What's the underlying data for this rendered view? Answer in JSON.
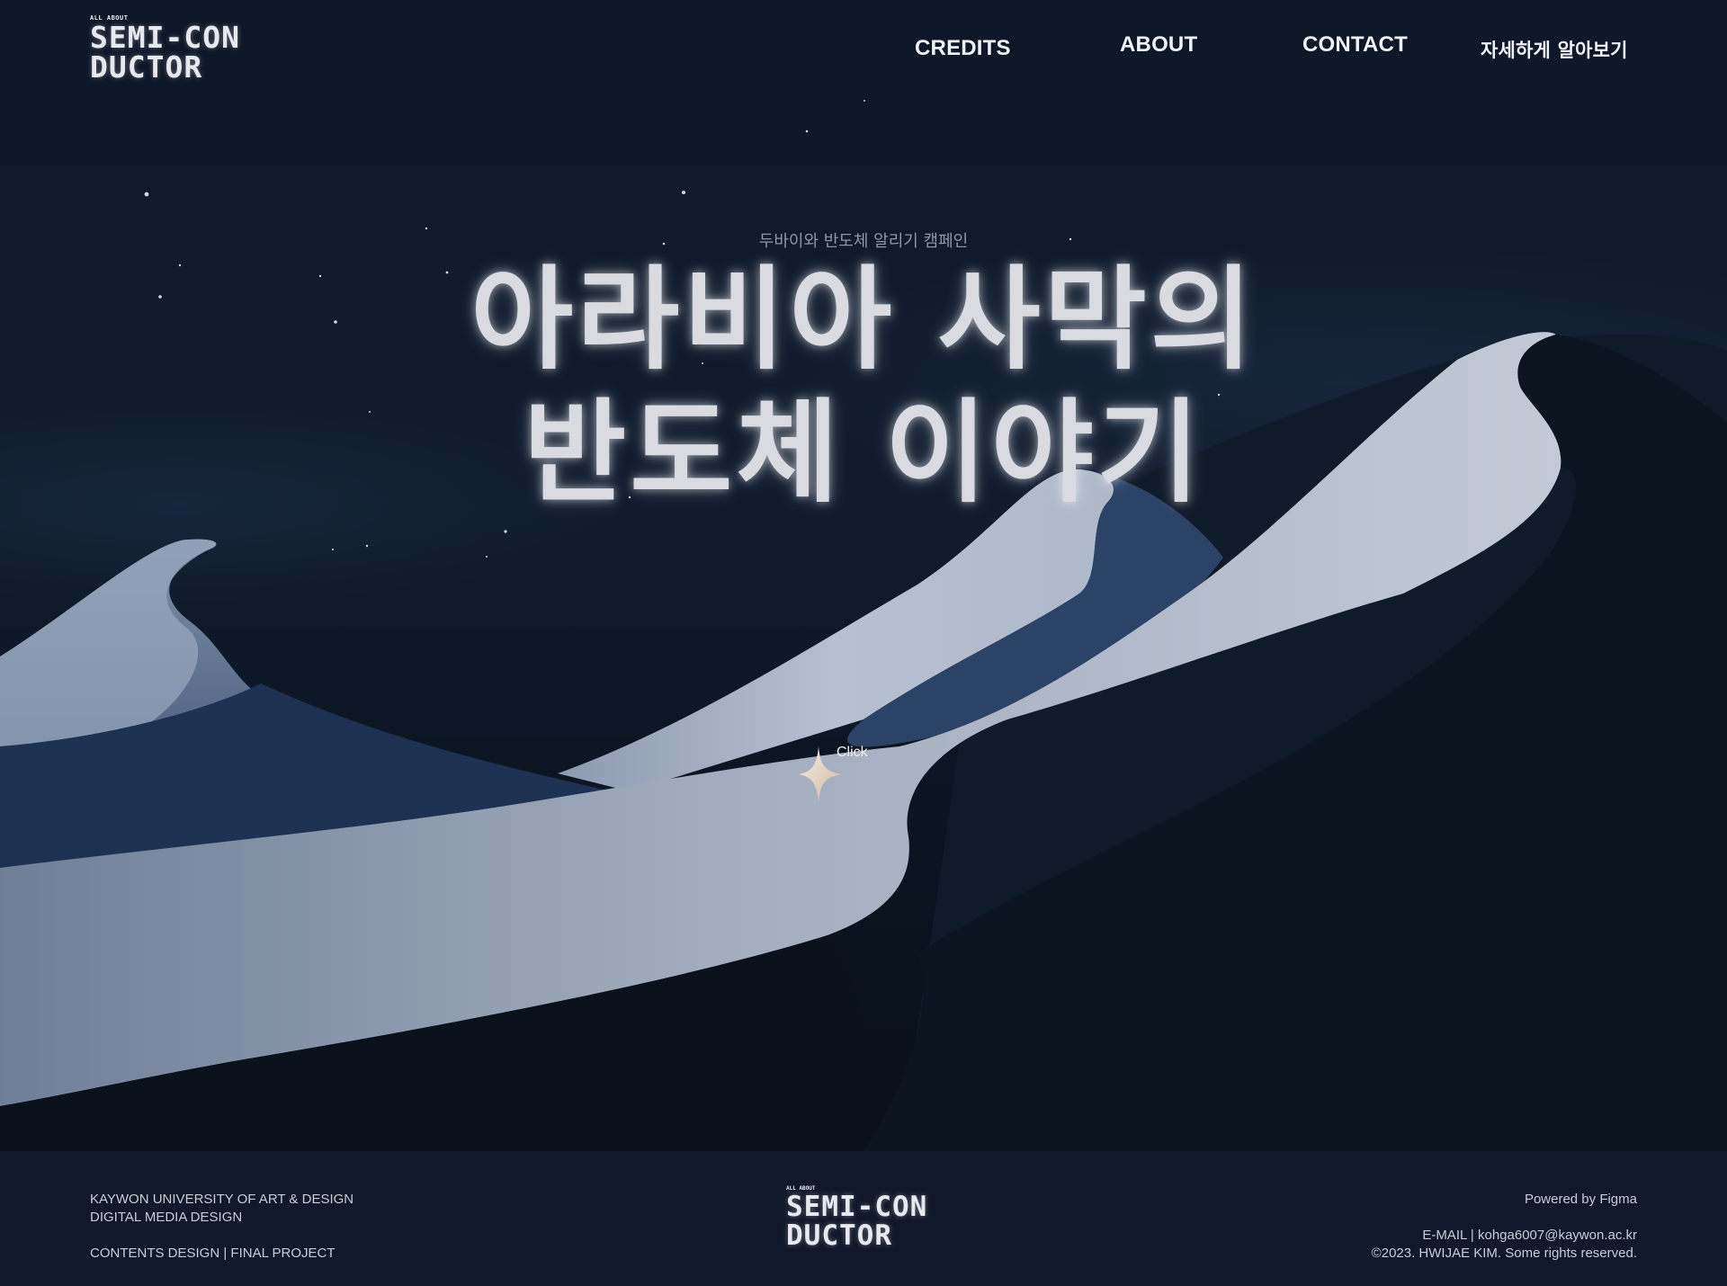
{
  "header": {
    "logo_small": "ALL ABOUT",
    "logo_line1": "SEMI-CON",
    "logo_line2": "DUCTOR",
    "nav": [
      "CREDITS",
      "ABOUT",
      "CONTACT",
      "자세하게 알아보기"
    ]
  },
  "hero": {
    "subtitle": "두바이와 반도체 알리기 캠페인",
    "headline_line1": "아라비아 사막의",
    "headline_line2": "반도체 이야기",
    "click_label": "Click"
  },
  "footer": {
    "left_line1": "KAYWON UNIVERSITY OF ART & DESIGN",
    "left_line2": "DIGITAL MEDIA DESIGN",
    "left_line3": "CONTENTS DESIGN | FINAL PROJECT",
    "logo_small": "ALL ABOUT",
    "logo_line1": "SEMI-CON",
    "logo_line2": "DUCTOR",
    "powered": "Powered by Figma",
    "email": "E-MAIL | kohga6007@kaywon.ac.kr",
    "copyright": "©2023. HWIJAE KIM. Some rights reserved."
  },
  "colors": {
    "sky": "#101a2b",
    "dune_light": "#b9c2d2",
    "dune_shadow": "#0c1420",
    "footer_bg": "#111829",
    "sparkle": "#e8d6c4"
  },
  "icons": {
    "sparkle": "four-point-star-icon"
  }
}
